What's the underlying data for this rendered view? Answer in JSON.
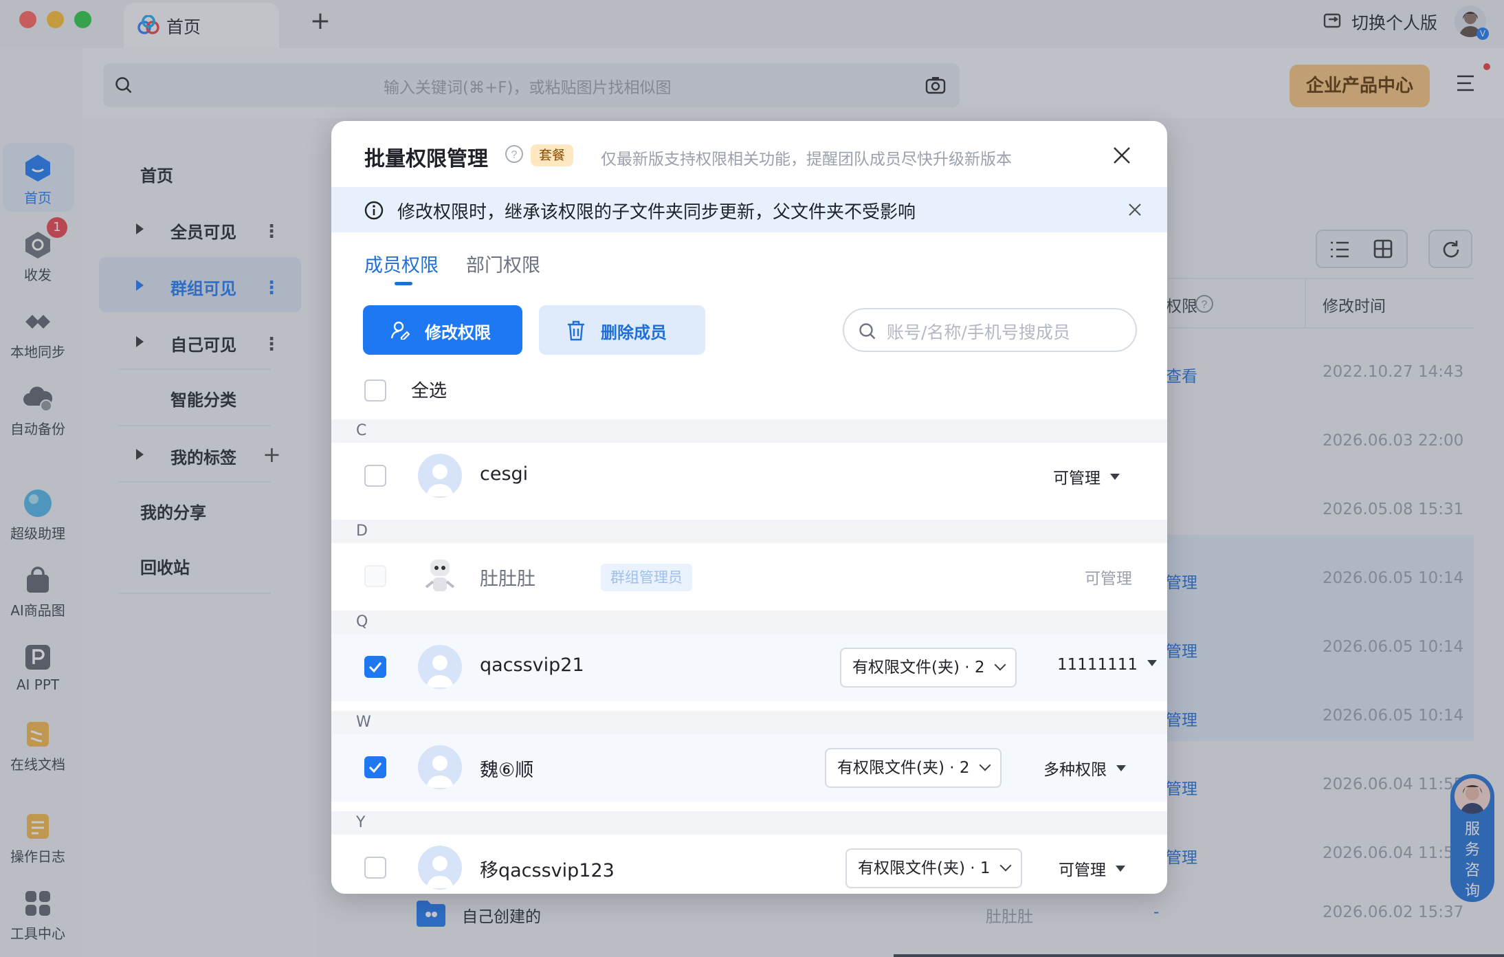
{
  "window": {
    "tab_title": "首页",
    "new_tab": "+",
    "switch_label": "切换个人版"
  },
  "search": {
    "placeholder": "输入关键词(⌘+F)，或粘贴图片找相似图"
  },
  "enterprise_btn": "企业产品中心",
  "rail": {
    "items": [
      "首页",
      "收发",
      "本地同步",
      "自动备份",
      "超级助理",
      "AI商品图",
      "AI PPT",
      "在线文档",
      "操作日志",
      "工具中心"
    ],
    "badge": "1"
  },
  "nav": {
    "home": "首页",
    "all_visible": "全员可见",
    "group_visible": "群组可见",
    "self_visible": "自己可见",
    "smart_cat": "智能分类",
    "my_tags": "我的标签",
    "my_share": "我的分享",
    "recycle": "回收站"
  },
  "table": {
    "col_perm": "权限",
    "col_time": "修改时间",
    "rows": [
      {
        "perm": "查看",
        "time": "2022.10.27 14:43"
      },
      {
        "perm": "",
        "time": "2026.06.03 22:00"
      },
      {
        "perm": "",
        "time": "2026.05.08 15:31"
      },
      {
        "perm": "管理",
        "time": "2026.06.05 10:14"
      },
      {
        "perm": "管理",
        "time": "2026.06.05 10:14"
      },
      {
        "perm": "管理",
        "time": "2026.06.05 10:14"
      },
      {
        "perm": "管理",
        "time": "2026.06.04 11:55"
      },
      {
        "perm": "管理",
        "time": "2026.06.04 11:57"
      }
    ],
    "bottom_row": {
      "name": "自己创建的",
      "owner": "肚肚肚",
      "perm": "-",
      "time": "2026.06.02 15:37"
    }
  },
  "service": "服务咨询",
  "modal": {
    "title": "批量权限管理",
    "badge": "套餐",
    "hint": "仅最新版支持权限相关功能，提醒团队成员尽快升级新版本",
    "notice": "修改权限时，继承该权限的子文件夹同步更新，父文件夹不受影响",
    "tabs": [
      "成员权限",
      "部门权限"
    ],
    "btn_modify": "修改权限",
    "btn_delete": "删除成员",
    "member_search_placeholder": "账号/名称/手机号搜成员",
    "select_all": "全选",
    "groups": [
      {
        "letter": "C",
        "name": "cesgi",
        "perm": "可管理"
      },
      {
        "letter": "D",
        "name": "肚肚肚",
        "role": "群组管理员",
        "perm": "可管理"
      },
      {
        "letter": "Q",
        "name": "qacssvip21",
        "folder": "有权限文件(夹) · 2",
        "perm": "11111111"
      },
      {
        "letter": "W",
        "name": "魏⑥顺",
        "folder": "有权限文件(夹) · 2",
        "perm": "多种权限"
      },
      {
        "letter": "Y",
        "name": "移qacssvip123",
        "folder": "有权限文件(夹) · 1",
        "perm": "可管理"
      }
    ]
  },
  "colors": {
    "primary": "#1d78f2",
    "enterprise": "#f5c17c",
    "notice_bg": "#e6f1fd",
    "badge_red": "#e8414b"
  }
}
